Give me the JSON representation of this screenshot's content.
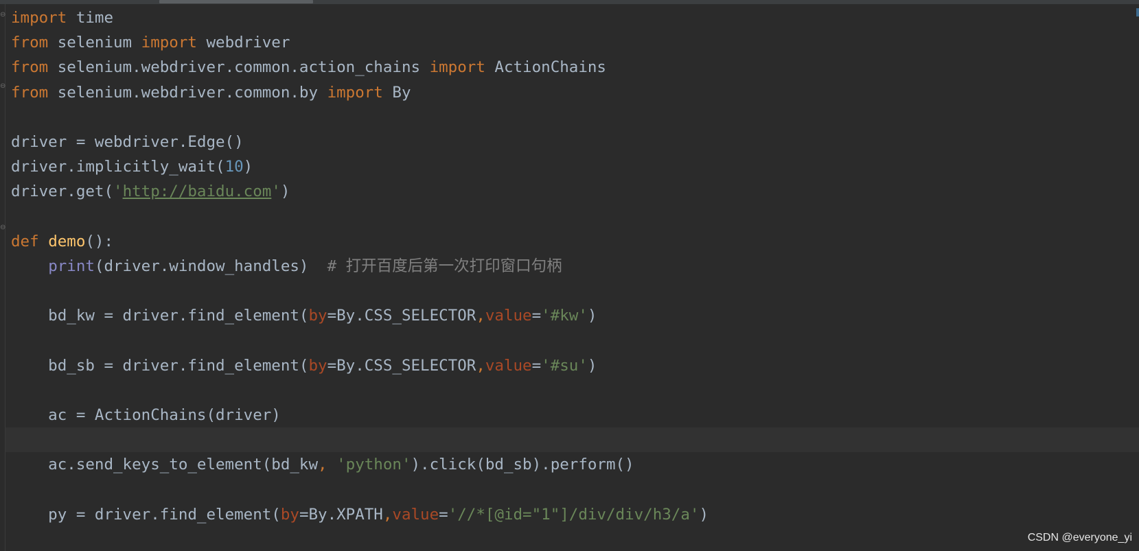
{
  "editor": {
    "language": "python",
    "lines": [
      [
        {
          "t": "import",
          "c": "kw"
        },
        {
          "t": " time",
          "c": "id"
        }
      ],
      [
        {
          "t": "from",
          "c": "kw"
        },
        {
          "t": " selenium ",
          "c": "id"
        },
        {
          "t": "import",
          "c": "kw"
        },
        {
          "t": " webdriver",
          "c": "id"
        }
      ],
      [
        {
          "t": "from",
          "c": "kw"
        },
        {
          "t": " selenium.webdriver.common.action_chains ",
          "c": "id"
        },
        {
          "t": "import",
          "c": "kw"
        },
        {
          "t": " ActionChains",
          "c": "id"
        }
      ],
      [
        {
          "t": "from",
          "c": "kw"
        },
        {
          "t": " selenium.webdriver.common.by ",
          "c": "id"
        },
        {
          "t": "import",
          "c": "kw"
        },
        {
          "t": " By",
          "c": "id"
        }
      ],
      [],
      [
        {
          "t": "driver = webdriver.Edge()",
          "c": "id"
        }
      ],
      [
        {
          "t": "driver.implicitly_wait(",
          "c": "id"
        },
        {
          "t": "10",
          "c": "num"
        },
        {
          "t": ")",
          "c": "id"
        }
      ],
      [
        {
          "t": "driver.get(",
          "c": "id"
        },
        {
          "t": "'",
          "c": "str"
        },
        {
          "t": "http://baidu.com",
          "c": "url"
        },
        {
          "t": "'",
          "c": "str"
        },
        {
          "t": ")",
          "c": "id"
        }
      ],
      [],
      [
        {
          "t": "def",
          "c": "kw"
        },
        {
          "t": " ",
          "c": "id"
        },
        {
          "t": "demo",
          "c": "fn"
        },
        {
          "t": "():",
          "c": "id"
        }
      ],
      [
        {
          "t": "    ",
          "c": "id"
        },
        {
          "t": "print",
          "c": "bi"
        },
        {
          "t": "(driver.window_handles)  ",
          "c": "id"
        },
        {
          "t": "# 打开百度后第一次打印窗口句柄",
          "c": "cmt"
        }
      ],
      [],
      [
        {
          "t": "    bd_kw = driver.find_element(",
          "c": "id"
        },
        {
          "t": "by",
          "c": "param"
        },
        {
          "t": "=By.CSS_SELECTOR",
          "c": "id"
        },
        {
          "t": ",",
          "c": "comma"
        },
        {
          "t": "value",
          "c": "param"
        },
        {
          "t": "=",
          "c": "id"
        },
        {
          "t": "'#kw'",
          "c": "str"
        },
        {
          "t": ")",
          "c": "id"
        }
      ],
      [],
      [
        {
          "t": "    bd_sb = driver.find_element(",
          "c": "id"
        },
        {
          "t": "by",
          "c": "param"
        },
        {
          "t": "=By.CSS_SELECTOR",
          "c": "id"
        },
        {
          "t": ",",
          "c": "comma"
        },
        {
          "t": "value",
          "c": "param"
        },
        {
          "t": "=",
          "c": "id"
        },
        {
          "t": "'#su'",
          "c": "str"
        },
        {
          "t": ")",
          "c": "id"
        }
      ],
      [],
      [
        {
          "t": "    ac = ActionChains(driver)",
          "c": "id"
        }
      ],
      [],
      [
        {
          "t": "    ac.send_keys_to_element(bd_kw",
          "c": "id"
        },
        {
          "t": ",",
          "c": "comma"
        },
        {
          "t": " ",
          "c": "id"
        },
        {
          "t": "'python'",
          "c": "str"
        },
        {
          "t": ").click(bd_sb).perform()",
          "c": "id"
        }
      ],
      [],
      [
        {
          "t": "    py = driver.find_element(",
          "c": "id"
        },
        {
          "t": "by",
          "c": "param"
        },
        {
          "t": "=By.XPATH",
          "c": "id"
        },
        {
          "t": ",",
          "c": "comma"
        },
        {
          "t": "value",
          "c": "param"
        },
        {
          "t": "=",
          "c": "id"
        },
        {
          "t": "'//*[@id=\"1\"]/div/div/h3/a'",
          "c": "str"
        },
        {
          "t": ")",
          "c": "id"
        }
      ]
    ]
  },
  "colors": {
    "background": "#2b2b2b",
    "keyword": "#cc7832",
    "function_name": "#ffc66d",
    "builtin": "#8888c6",
    "number": "#6897bb",
    "string": "#6a8759",
    "parameter": "#aa4926",
    "comment": "#808080",
    "identifier": "#a9b7c6"
  },
  "icons": {
    "fold_marker": "fold-marker-icon"
  },
  "watermark": {
    "text": "CSDN @everyone_yi"
  }
}
